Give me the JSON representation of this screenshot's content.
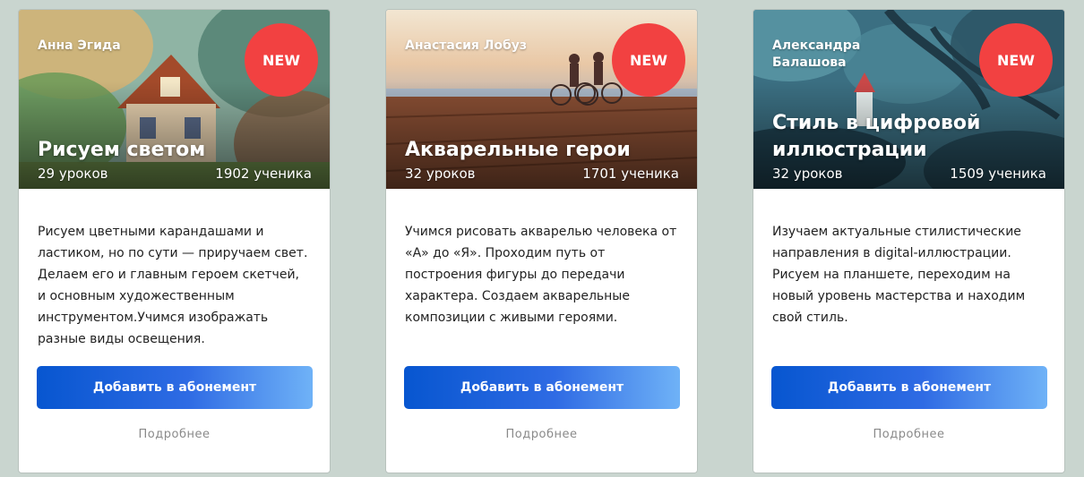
{
  "colors": {
    "background": "#c9d5cf",
    "badge": "#f24141",
    "button_gradient_start": "#0756d0",
    "button_gradient_end": "#6fb2f7"
  },
  "courses": [
    {
      "author": "Анна Эгида",
      "badge": "NEW",
      "title": "Рисуем светом",
      "lessons": "29 уроков",
      "students": "1902 ученика",
      "description": "Рисуем цветными карандашами и ластиком, но по сути — приручаем свет. Делаем его и главным героем скетчей, и основным художественным инструментом.Учимся изображать разные виды освещения.",
      "button": "Добавить в абонемент",
      "more": "Подробнее",
      "cover_icon": "watercolor-house-image"
    },
    {
      "author": "Анастасия Лобуз",
      "badge": "NEW",
      "title": "Акварельные герои",
      "lessons": "32 уроков",
      "students": "1701 ученика",
      "description": "Учимся рисовать акварелью человека от «А» до «Я». Проходим путь от построения фигуры до передачи характера. Создаем акварельные композиции с живыми героями.",
      "button": "Добавить в абонемент",
      "more": "Подробнее",
      "cover_icon": "cyclists-pier-image"
    },
    {
      "author": "Александра Балашова",
      "badge": "NEW",
      "title": "Стиль в цифровой иллюстрации",
      "lessons": "32 уроков",
      "students": "1509 ученика",
      "description": "Изучаем актуальные стилистические направления в digital-иллюстрации. Рисуем на планшете, переходим на новый уровень мастерства и находим свой стиль.",
      "button": "Добавить в абонемент",
      "more": "Подробнее",
      "cover_icon": "digital-forest-image"
    }
  ]
}
